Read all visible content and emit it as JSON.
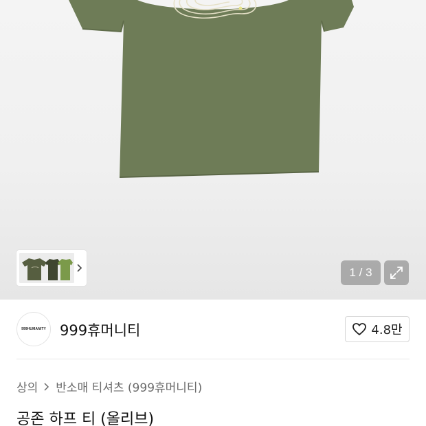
{
  "gallery": {
    "counter": "1 / 3",
    "icons": {
      "expand": "expand-icon",
      "next": "chevron-right-icon"
    }
  },
  "brand": {
    "logo_text": "999HUMANITY",
    "name": "999휴머니티",
    "like_count": "4.8만",
    "like_icon": "heart-icon"
  },
  "breadcrumb": {
    "items": [
      "상의",
      "반소매 티셔츠 (999휴머니티)"
    ],
    "separator_icon": "chevron-right-icon"
  },
  "product": {
    "title": "공존 하프 티 (올리브)"
  },
  "colors": {
    "shirt": "#6e7c57",
    "text_primary": "#111111",
    "text_secondary": "#6b6b6b",
    "badge_bg": "#969696"
  }
}
